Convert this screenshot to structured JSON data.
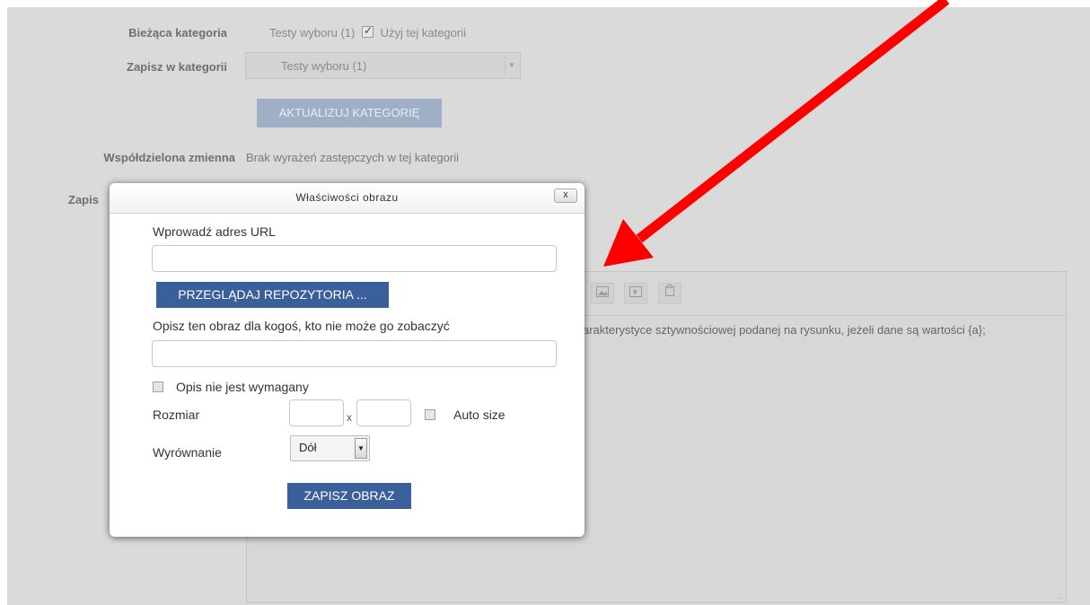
{
  "form": {
    "current_category_label": "Bieżąca kategoria",
    "current_category_value": "Testy wyboru (1)",
    "use_category_label": "Użyj tej kategorii",
    "save_in_category_label": "Zapisz w kategorii",
    "save_in_category_value": "Testy wyboru (1)",
    "update_category_button": "AKTUALIZUJ KATEGORIĘ",
    "shared_variable_label": "Współdzielona zmienna",
    "shared_variable_value": "Brak wyrażeń zastępczych w tej kategorii",
    "partial_label": "Zapis"
  },
  "editor": {
    "visible_text": "arakterystyce sztywnościowej podanej na rysunku, jeżeli dane są wartości {a};",
    "toolbar_icons": [
      "image-icon",
      "media-icon",
      "manage-files-icon"
    ]
  },
  "dialog": {
    "title": "Właściwości obrazu",
    "close_label": "x",
    "url_label": "Wprowadź adres URL",
    "url_value": "",
    "browse_button": "PRZEGLĄDAJ REPOZYTORIA ...",
    "alt_label": "Opisz ten obraz dla kogoś, kto nie może go zobaczyć",
    "alt_value": "",
    "alt_not_required_label": "Opis nie jest wymagany",
    "size_label": "Rozmiar",
    "size_separator": "x",
    "auto_size_label": "Auto size",
    "align_label": "Wyrównanie",
    "align_value": "Dół",
    "save_button": "ZAPISZ OBRAZ"
  },
  "annotation": {
    "arrow_color": "#ff0000"
  }
}
